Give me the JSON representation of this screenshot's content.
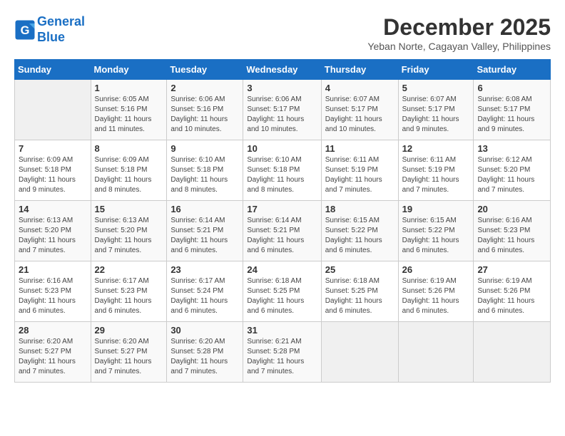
{
  "logo": {
    "line1": "General",
    "line2": "Blue"
  },
  "title": "December 2025",
  "location": "Yeban Norte, Cagayan Valley, Philippines",
  "weekdays": [
    "Sunday",
    "Monday",
    "Tuesday",
    "Wednesday",
    "Thursday",
    "Friday",
    "Saturday"
  ],
  "weeks": [
    [
      {
        "day": "",
        "info": ""
      },
      {
        "day": "1",
        "info": "Sunrise: 6:05 AM\nSunset: 5:16 PM\nDaylight: 11 hours and 11 minutes."
      },
      {
        "day": "2",
        "info": "Sunrise: 6:06 AM\nSunset: 5:16 PM\nDaylight: 11 hours and 10 minutes."
      },
      {
        "day": "3",
        "info": "Sunrise: 6:06 AM\nSunset: 5:17 PM\nDaylight: 11 hours and 10 minutes."
      },
      {
        "day": "4",
        "info": "Sunrise: 6:07 AM\nSunset: 5:17 PM\nDaylight: 11 hours and 10 minutes."
      },
      {
        "day": "5",
        "info": "Sunrise: 6:07 AM\nSunset: 5:17 PM\nDaylight: 11 hours and 9 minutes."
      },
      {
        "day": "6",
        "info": "Sunrise: 6:08 AM\nSunset: 5:17 PM\nDaylight: 11 hours and 9 minutes."
      }
    ],
    [
      {
        "day": "7",
        "info": "Sunrise: 6:09 AM\nSunset: 5:18 PM\nDaylight: 11 hours and 9 minutes."
      },
      {
        "day": "8",
        "info": "Sunrise: 6:09 AM\nSunset: 5:18 PM\nDaylight: 11 hours and 8 minutes."
      },
      {
        "day": "9",
        "info": "Sunrise: 6:10 AM\nSunset: 5:18 PM\nDaylight: 11 hours and 8 minutes."
      },
      {
        "day": "10",
        "info": "Sunrise: 6:10 AM\nSunset: 5:18 PM\nDaylight: 11 hours and 8 minutes."
      },
      {
        "day": "11",
        "info": "Sunrise: 6:11 AM\nSunset: 5:19 PM\nDaylight: 11 hours and 7 minutes."
      },
      {
        "day": "12",
        "info": "Sunrise: 6:11 AM\nSunset: 5:19 PM\nDaylight: 11 hours and 7 minutes."
      },
      {
        "day": "13",
        "info": "Sunrise: 6:12 AM\nSunset: 5:20 PM\nDaylight: 11 hours and 7 minutes."
      }
    ],
    [
      {
        "day": "14",
        "info": "Sunrise: 6:13 AM\nSunset: 5:20 PM\nDaylight: 11 hours and 7 minutes."
      },
      {
        "day": "15",
        "info": "Sunrise: 6:13 AM\nSunset: 5:20 PM\nDaylight: 11 hours and 7 minutes."
      },
      {
        "day": "16",
        "info": "Sunrise: 6:14 AM\nSunset: 5:21 PM\nDaylight: 11 hours and 6 minutes."
      },
      {
        "day": "17",
        "info": "Sunrise: 6:14 AM\nSunset: 5:21 PM\nDaylight: 11 hours and 6 minutes."
      },
      {
        "day": "18",
        "info": "Sunrise: 6:15 AM\nSunset: 5:22 PM\nDaylight: 11 hours and 6 minutes."
      },
      {
        "day": "19",
        "info": "Sunrise: 6:15 AM\nSunset: 5:22 PM\nDaylight: 11 hours and 6 minutes."
      },
      {
        "day": "20",
        "info": "Sunrise: 6:16 AM\nSunset: 5:23 PM\nDaylight: 11 hours and 6 minutes."
      }
    ],
    [
      {
        "day": "21",
        "info": "Sunrise: 6:16 AM\nSunset: 5:23 PM\nDaylight: 11 hours and 6 minutes."
      },
      {
        "day": "22",
        "info": "Sunrise: 6:17 AM\nSunset: 5:23 PM\nDaylight: 11 hours and 6 minutes."
      },
      {
        "day": "23",
        "info": "Sunrise: 6:17 AM\nSunset: 5:24 PM\nDaylight: 11 hours and 6 minutes."
      },
      {
        "day": "24",
        "info": "Sunrise: 6:18 AM\nSunset: 5:25 PM\nDaylight: 11 hours and 6 minutes."
      },
      {
        "day": "25",
        "info": "Sunrise: 6:18 AM\nSunset: 5:25 PM\nDaylight: 11 hours and 6 minutes."
      },
      {
        "day": "26",
        "info": "Sunrise: 6:19 AM\nSunset: 5:26 PM\nDaylight: 11 hours and 6 minutes."
      },
      {
        "day": "27",
        "info": "Sunrise: 6:19 AM\nSunset: 5:26 PM\nDaylight: 11 hours and 6 minutes."
      }
    ],
    [
      {
        "day": "28",
        "info": "Sunrise: 6:20 AM\nSunset: 5:27 PM\nDaylight: 11 hours and 7 minutes."
      },
      {
        "day": "29",
        "info": "Sunrise: 6:20 AM\nSunset: 5:27 PM\nDaylight: 11 hours and 7 minutes."
      },
      {
        "day": "30",
        "info": "Sunrise: 6:20 AM\nSunset: 5:28 PM\nDaylight: 11 hours and 7 minutes."
      },
      {
        "day": "31",
        "info": "Sunrise: 6:21 AM\nSunset: 5:28 PM\nDaylight: 11 hours and 7 minutes."
      },
      {
        "day": "",
        "info": ""
      },
      {
        "day": "",
        "info": ""
      },
      {
        "day": "",
        "info": ""
      }
    ]
  ]
}
